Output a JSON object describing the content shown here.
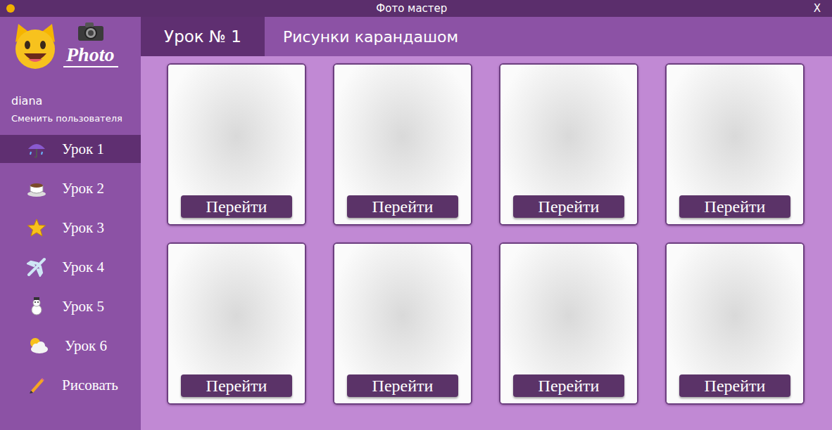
{
  "window": {
    "title": "Фото мастер",
    "close": "X"
  },
  "logo": {
    "text": "Photo"
  },
  "user": {
    "name": "diana",
    "switch": "Сменить пользователя"
  },
  "sidebar": {
    "items": [
      {
        "label": "Урок 1",
        "selected": true
      },
      {
        "label": "Урок 2",
        "selected": false
      },
      {
        "label": "Урок 3",
        "selected": false
      },
      {
        "label": "Урок 4",
        "selected": false
      },
      {
        "label": "Урок 5",
        "selected": false
      },
      {
        "label": "Урок 6",
        "selected": false
      },
      {
        "label": "Рисовать",
        "selected": false
      }
    ]
  },
  "header": {
    "lesson": "Урок № 1",
    "title": "Рисунки карандашом"
  },
  "cards": [
    {
      "button": "Перейти"
    },
    {
      "button": "Перейти"
    },
    {
      "button": "Перейти"
    },
    {
      "button": "Перейти"
    },
    {
      "button": "Перейти"
    },
    {
      "button": "Перейти"
    },
    {
      "button": "Перейти"
    },
    {
      "button": "Перейти"
    }
  ]
}
